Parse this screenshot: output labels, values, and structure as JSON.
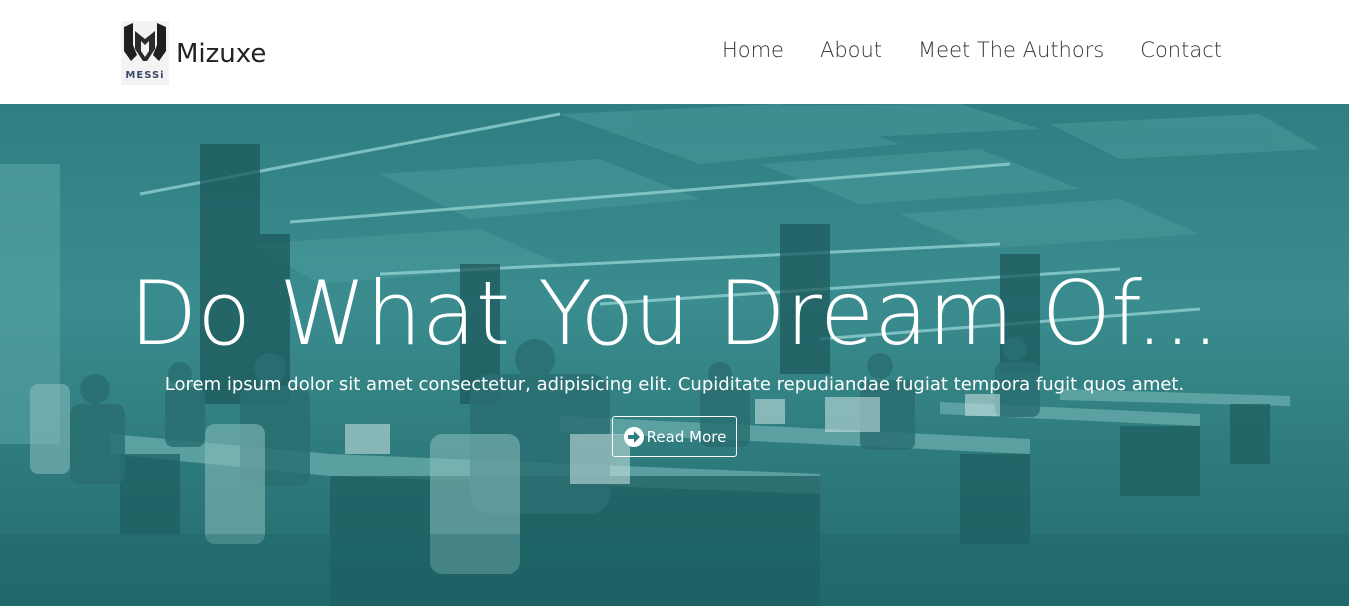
{
  "brand": {
    "name": "Mizuxe",
    "logo_text": "MESSi"
  },
  "nav": {
    "items": [
      "Home",
      "About",
      "Meet The Authors",
      "Contact"
    ]
  },
  "hero": {
    "title": "Do What You Dream Of...",
    "subtitle": "Lorem ipsum dolor sit amet consectetur, adipisicing elit. Cupiditate repudiandae fugiat tempora fugit quos amet.",
    "button_label": "Read More",
    "button_icon": "arrow-circle-right-icon",
    "overlay_color": "#2f7f82"
  }
}
